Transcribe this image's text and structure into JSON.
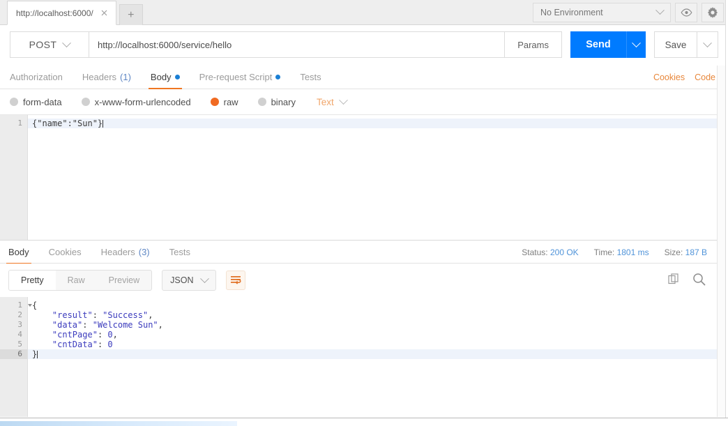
{
  "window": {
    "request_tab_label": "http://localhost:6000/",
    "close_icon": "close-icon",
    "new_tab_label": "+",
    "environment": {
      "selected": "No Environment",
      "eye_icon": "eye-icon",
      "gear_icon": "gear-icon"
    }
  },
  "urlbar": {
    "method": "POST",
    "url": "http://localhost:6000/service/hello",
    "params_label": "Params",
    "send_label": "Send",
    "save_label": "Save"
  },
  "request_tabs": {
    "items": [
      {
        "label": "Authorization",
        "count": "",
        "dot": false,
        "active": false
      },
      {
        "label": "Headers",
        "count": "(1)",
        "dot": false,
        "active": false
      },
      {
        "label": "Body",
        "count": "",
        "dot": true,
        "active": true
      },
      {
        "label": "Pre-request Script",
        "count": "",
        "dot": true,
        "active": false
      },
      {
        "label": "Tests",
        "count": "",
        "dot": false,
        "active": false
      }
    ],
    "cookies_link": "Cookies",
    "code_link": "Code"
  },
  "body_type": {
    "options": [
      {
        "label": "form-data",
        "selected": false
      },
      {
        "label": "x-www-form-urlencoded",
        "selected": false
      },
      {
        "label": "raw",
        "selected": true
      },
      {
        "label": "binary",
        "selected": false
      }
    ],
    "format": "Text"
  },
  "request_body": {
    "lines": [
      {
        "no": "1",
        "text": "{\"name\":\"Sun\"}",
        "highlight": true
      }
    ]
  },
  "response_tabs": {
    "items": [
      {
        "label": "Body",
        "count": "",
        "active": true
      },
      {
        "label": "Cookies",
        "count": "",
        "active": false
      },
      {
        "label": "Headers",
        "count": "(3)",
        "active": false
      },
      {
        "label": "Tests",
        "count": "",
        "active": false
      }
    ],
    "status_label": "Status:",
    "status_value": "200 OK",
    "time_label": "Time:",
    "time_value": "1801 ms",
    "size_label": "Size:",
    "size_value": "187 B"
  },
  "response_toolbar": {
    "views": [
      {
        "label": "Pretty",
        "active": true
      },
      {
        "label": "Raw",
        "active": false
      },
      {
        "label": "Preview",
        "active": false
      }
    ],
    "format": "JSON",
    "wrap_icon": "wrap-text-icon",
    "copy_icon": "copy-icon",
    "search_icon": "search-icon"
  },
  "response_body": {
    "lines": [
      {
        "no": "1",
        "fold": true,
        "indent": 0,
        "kind": "brace",
        "text": "{",
        "highlight": false
      },
      {
        "no": "2",
        "fold": false,
        "indent": 1,
        "kind": "pair",
        "key": "\"result\"",
        "value": "\"Success\"",
        "trail": ",",
        "highlight": false
      },
      {
        "no": "3",
        "fold": false,
        "indent": 1,
        "kind": "pair",
        "key": "\"data\"",
        "value": "\"Welcome Sun\"",
        "trail": ",",
        "highlight": false
      },
      {
        "no": "4",
        "fold": false,
        "indent": 1,
        "kind": "pair",
        "key": "\"cntPage\"",
        "value": "0",
        "trail": ",",
        "highlight": false
      },
      {
        "no": "5",
        "fold": false,
        "indent": 1,
        "kind": "pair",
        "key": "\"cntData\"",
        "value": "0",
        "trail": "",
        "highlight": false
      },
      {
        "no": "6",
        "fold": false,
        "indent": 0,
        "kind": "brace",
        "text": "}",
        "highlight": true
      }
    ]
  },
  "colors": {
    "accent_orange": "#ef7622",
    "send_blue": "#007bff",
    "status_blue": "#4f93d9",
    "json_token": "#3b3bbd"
  }
}
